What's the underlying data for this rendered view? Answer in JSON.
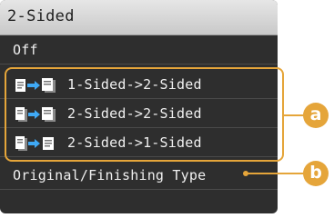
{
  "title": "2-Sided",
  "items": [
    {
      "label": "Off"
    },
    {
      "label": "1-Sided->2-Sided",
      "icon": "one-sided-to-two-sided-icon"
    },
    {
      "label": "2-Sided->2-Sided",
      "icon": "two-sided-to-two-sided-icon"
    },
    {
      "label": "2-Sided->1-Sided",
      "icon": "two-sided-to-one-sided-icon"
    },
    {
      "label": "Original/Finishing Type"
    }
  ],
  "callouts": {
    "a": "a",
    "b": "b"
  },
  "colors": {
    "accent": "#e5a53a",
    "screen_bg": "#2e2e2e",
    "arrow": "#3fa9f5"
  }
}
